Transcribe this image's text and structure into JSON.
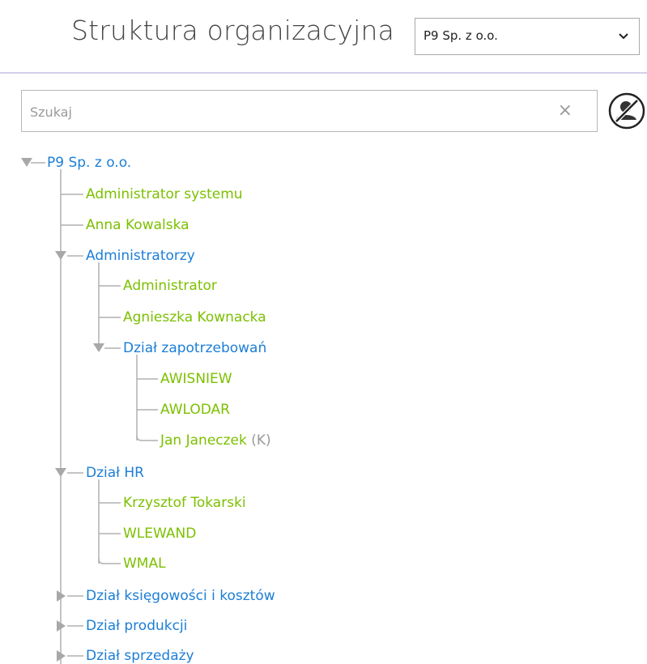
{
  "header": {
    "title": "Struktura organizacyjna",
    "company_select": {
      "selected": "P9 Sp. z o.o."
    }
  },
  "search": {
    "placeholder": "Szukaj",
    "clear_glyph": "×"
  },
  "colors": {
    "org_unit": "#1c7ed6",
    "user": "#7cc000",
    "tree_line": "#b0b0b0",
    "divider": "#d3d1e8"
  },
  "tree": {
    "root": {
      "label": "P9 Sp. z o.o.",
      "expanded": true,
      "children": [
        {
          "label": "Administrator systemu",
          "type": "user"
        },
        {
          "label": "Anna Kowalska",
          "type": "user"
        },
        {
          "label": "Administratorzy",
          "type": "org",
          "expanded": true,
          "children": [
            {
              "label": "Administrator",
              "type": "user"
            },
            {
              "label": "Agnieszka Kownacka",
              "type": "user"
            },
            {
              "label": "Dział zapotrzebowań",
              "type": "org",
              "expanded": true,
              "children": [
                {
                  "label": "AWISNIEW",
                  "type": "user"
                },
                {
                  "label": "AWLODAR",
                  "type": "user"
                },
                {
                  "label": "Jan Janeczek",
                  "suffix": "(K)",
                  "type": "user"
                }
              ]
            }
          ]
        },
        {
          "label": "Dział HR",
          "type": "org",
          "expanded": true,
          "children": [
            {
              "label": "Krzysztof Tokarski",
              "type": "user"
            },
            {
              "label": "WLEWAND",
              "type": "user"
            },
            {
              "label": "WMAL",
              "type": "user"
            }
          ]
        },
        {
          "label": "Dział księgowości i kosztów",
          "type": "org",
          "expanded": false
        },
        {
          "label": "Dział produkcji",
          "type": "org",
          "expanded": false
        },
        {
          "label": "Dział sprzedaży",
          "type": "org",
          "expanded": false
        }
      ]
    }
  }
}
